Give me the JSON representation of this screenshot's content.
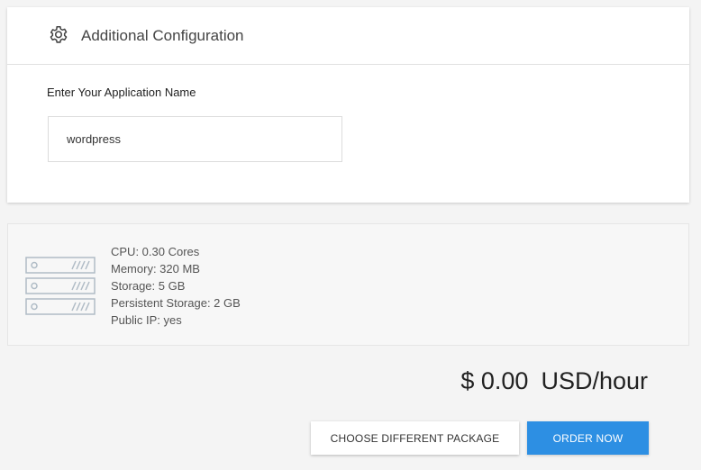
{
  "config": {
    "title": "Additional Configuration",
    "icon": "gear-icon",
    "app_name_label": "Enter Your Application Name",
    "app_name_value": "wordpress",
    "app_name_placeholder": ""
  },
  "package": {
    "icon": "server-icon",
    "specs": [
      "CPU: 0.30 Cores",
      "Memory: 320 MB",
      "Storage: 5 GB",
      "Persistent Storage: 2 GB",
      "Public IP: yes"
    ]
  },
  "pricing": {
    "amount": "$ 0.00",
    "unit": "USD/hour"
  },
  "actions": {
    "choose_label": "CHOOSE DIFFERENT PACKAGE",
    "order_label": "ORDER NOW"
  },
  "colors": {
    "primary": "#2d8fe3",
    "icon_stroke": "#b0bcc6"
  }
}
